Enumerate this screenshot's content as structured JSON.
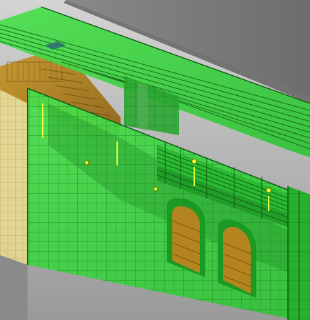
{
  "scene": {
    "description_hidden": "",
    "colors": {
      "background_light": "#c9c9c9",
      "background_mid": "#a8a8a8",
      "floor_dark": "#7f7f7f",
      "roof_top": "#7b7b7b",
      "green_fill": "#39d43f",
      "green_dark": "#1f8f26",
      "green_line": "#0e5a12",
      "yellow_wall": "#e8dc9a",
      "yellow_line": "#b59a3a",
      "stair_fill": "#b4841e",
      "stair_line": "#6c4a0c",
      "accent_yellow": "#e6ff3a"
    },
    "rendering_mode": "x-ray",
    "objects": [
      {
        "kind": "roof-slab"
      },
      {
        "kind": "beam-cluster"
      },
      {
        "kind": "back-wall"
      },
      {
        "kind": "yellow-wall"
      },
      {
        "kind": "stair"
      },
      {
        "kind": "front-wall"
      },
      {
        "kind": "arch-opening",
        "count": 2
      },
      {
        "kind": "balcony-rail"
      },
      {
        "kind": "right-column"
      }
    ]
  }
}
